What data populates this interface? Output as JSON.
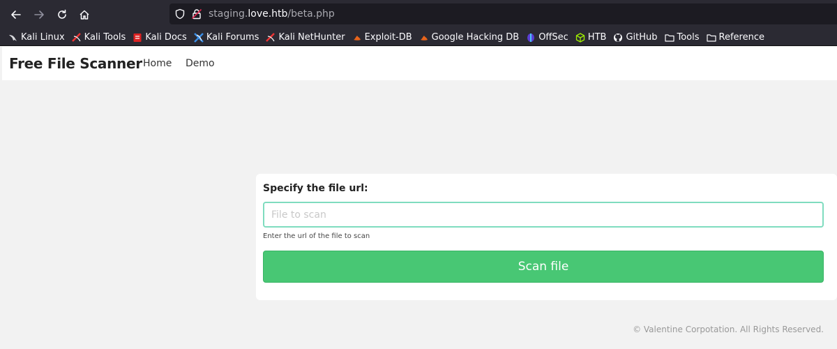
{
  "browser": {
    "url": {
      "prefix": "staging.",
      "host": "love.htb",
      "path": "/beta.php"
    },
    "bookmarks": [
      {
        "label": "Kali Linux",
        "icon": "kali-dragon-icon"
      },
      {
        "label": "Kali Tools",
        "icon": "kali-tools-icon"
      },
      {
        "label": "Kali Docs",
        "icon": "kali-docs-icon"
      },
      {
        "label": "Kali Forums",
        "icon": "kali-forums-icon"
      },
      {
        "label": "Kali NetHunter",
        "icon": "kali-nethunter-icon"
      },
      {
        "label": "Exploit-DB",
        "icon": "exploit-db-icon"
      },
      {
        "label": "Google Hacking DB",
        "icon": "ghdb-icon"
      },
      {
        "label": "OffSec",
        "icon": "offsec-icon"
      },
      {
        "label": "HTB",
        "icon": "htb-cube-icon"
      },
      {
        "label": "GitHub",
        "icon": "github-icon"
      },
      {
        "label": "Tools",
        "icon": "folder-icon"
      },
      {
        "label": "Reference",
        "icon": "folder-icon"
      }
    ]
  },
  "navbar": {
    "brand": "Free File Scanner",
    "links": [
      "Home",
      "Demo"
    ]
  },
  "form": {
    "label": "Specify the file url:",
    "placeholder": "File to scan",
    "value": "",
    "help": "Enter the url of the file to scan",
    "button": "Scan file"
  },
  "footer": {
    "text": "© Valentine Corpotation. All Rights Reserved."
  },
  "colors": {
    "chrome_bg": "#2b2a33",
    "urlbar_bg": "#1c1b22",
    "page_bg": "#f2f2f2",
    "button_green": "#48c774",
    "input_border": "#7fdcbf"
  }
}
